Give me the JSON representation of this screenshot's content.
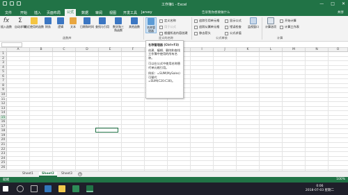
{
  "window": {
    "title": "工作簿1 - Excel",
    "controls": [
      "—",
      "□",
      "✕"
    ]
  },
  "ribbon_tabs": [
    "文件",
    "开始",
    "插入",
    "页面布局",
    "公式",
    "数据",
    "审阅",
    "视图",
    "开发工具",
    "Jarvey"
  ],
  "active_tab_index": 4,
  "tell_me_placeholder": "告诉我你想要做什么",
  "share_label": "共享",
  "ribbon": {
    "large_buttons": [
      {
        "label": "插入函数",
        "icon": "fx-icon"
      },
      {
        "label": "自动求和",
        "icon": "sigma-icon"
      },
      {
        "label": "最近使用的函数",
        "icon": "star-icon"
      },
      {
        "label": "财务",
        "icon": "book-icon"
      },
      {
        "label": "逻辑",
        "icon": "book-icon"
      },
      {
        "label": "文本",
        "icon": "book-icon"
      },
      {
        "label": "日期和时间",
        "icon": "book-icon"
      },
      {
        "label": "查找与引用",
        "icon": "book-icon"
      },
      {
        "label": "数学和三角函数",
        "icon": "book-icon"
      },
      {
        "label": "其他函数",
        "icon": "book-icon"
      },
      {
        "label": "名称管理器",
        "icon": "tag-icon"
      }
    ],
    "names_commands": [
      "定义名称",
      "用于公式",
      "根据所选内容创建"
    ],
    "audit_commands": [
      "追踪引用单元格",
      "追踪从属单元格",
      "移去箭头",
      "显示公式",
      "错误检查",
      "公式求值"
    ],
    "watch_label": "监视窗口",
    "calc_options_label": "计算选项",
    "calc_commands": [
      "开始计算",
      "计算工作表"
    ],
    "groups": [
      "函数库",
      "定义的名称",
      "公式审核",
      "计算"
    ]
  },
  "tooltip": {
    "title": "名称管理器 (Ctrl+F3)",
    "paragraphs": [
      "创建、编辑、删除和查找工作簿中使用的所有名称。",
      "可以在公式中使用名称替代单元格引用。",
      "例如：=SUM(MySales) 可替代 =SUM(C20:C30)。"
    ]
  },
  "columns": [
    "A",
    "B",
    "C",
    "D",
    "E",
    "F",
    "G",
    "H",
    "I",
    "J",
    "K",
    "L",
    "M",
    "N",
    "O",
    "P",
    "Q",
    "R"
  ],
  "rows": [
    "1",
    "2",
    "3",
    "4",
    "5",
    "6",
    "7",
    "8",
    "9",
    "10",
    "11",
    "12",
    "13",
    "14",
    "15",
    "16",
    "17",
    "18",
    "19",
    "20",
    "21",
    "22",
    "23",
    "24",
    "25",
    "26"
  ],
  "active_row": "15",
  "sheets": [
    "Sheet1",
    "Sheet2",
    "Sheet3"
  ],
  "active_sheet": "Sheet2",
  "status": {
    "ready": "就绪",
    "zoom": "100%"
  },
  "clock": {
    "time": "0:06",
    "date": "2018-07-03 星期二"
  },
  "colors": {
    "brand": "#217346",
    "taskbar": "#1f1f2a"
  }
}
